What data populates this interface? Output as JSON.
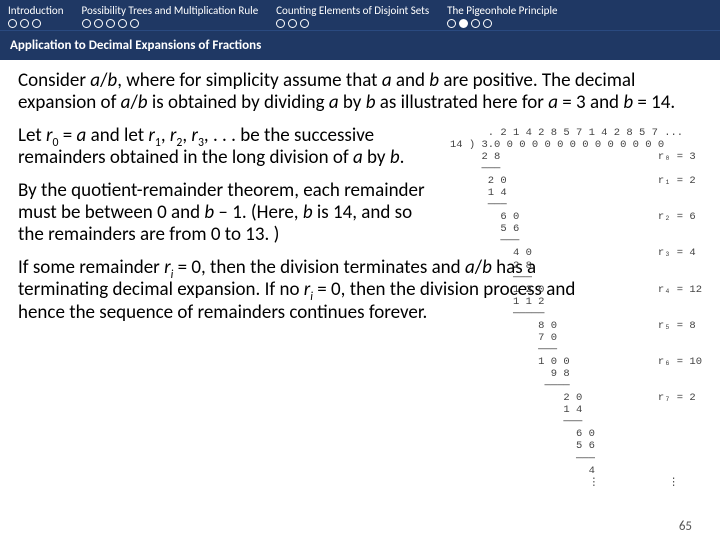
{
  "nav": {
    "sections": [
      {
        "title": "Introduction",
        "dots": [
          "o",
          "o",
          "o"
        ]
      },
      {
        "title": "Possibility Trees and Multiplication Rule",
        "dots": [
          "o",
          "o",
          "o",
          "o",
          "o"
        ]
      },
      {
        "title": "Counting Elements of Disjoint Sets",
        "dots": [
          "o",
          "o",
          "o"
        ]
      },
      {
        "title": "The Pigeonhole Principle",
        "dots": [
          "o",
          "f",
          "o",
          "o"
        ]
      }
    ]
  },
  "subtitle": "Application to Decimal Expansions of Fractions",
  "p1": {
    "t1": "Consider ",
    "ab1": "a",
    "slash1": "/",
    "ab2": "b",
    "t2": ", where for simplicity assume that ",
    "a": "a",
    "t3": " and ",
    "b": "b",
    "t4": " are positive. The decimal expansion of ",
    "ab3": "a",
    "slash2": "/",
    "ab4": "b",
    "t5": " is obtained by dividing ",
    "a2": "a",
    "t6": " by ",
    "b2": "b",
    "t7": " as illustrated here for ",
    "a3": "a",
    "eq3": " = 3 and ",
    "b3": "b",
    "eq14": " = 14."
  },
  "p2": {
    "t1": "Let ",
    "r": "r",
    "s0": "0",
    "eq": " = ",
    "a": "a",
    "t2": " and let ",
    "r1": "r",
    "s1": "1",
    "c1": ", ",
    "r2": "r",
    "s2": "2",
    "c2": ", ",
    "r3": "r",
    "s3": "3",
    "c3": ", . . . be the successive remainders obtained in the long division of ",
    "a2": "a",
    "by": " by ",
    "b": "b",
    "dot": "."
  },
  "p3": {
    "t1": "By the quotient-remainder theorem, each remainder must be between 0 and ",
    "b": "b",
    "t2": " – 1. (Here, ",
    "b2": "b",
    "t3": " is 14, and so the remainders are from 0 to 13. )"
  },
  "p4": {
    "t1": "If some remainder ",
    "r": "r",
    "si": "i",
    "t2": " = 0, then the division terminates and ",
    "a": "a",
    "slash": "/",
    "b": "b",
    "t3": " has a terminating decimal expansion. If no ",
    "r2": "r",
    "si2": "i",
    "t4": " = 0, then the division process and hence the sequence of remainders continues forever."
  },
  "longdiv": "      . 2 1 4 2 8 5 7 1 4 2 8 5 7 ...\n14 ) 3.0 0 0 0 0 0 0 0 0 0 0 0 0 0\n     2 8                         r₀ = 3\n     ───\n      2 0                        r₁ = 2\n      1 4\n      ───\n        6 0                      r₂ = 6\n        5 6\n        ───\n          4 0                    r₃ = 4\n          2 8\n          ───\n          1 2 0                  r₄ = 12\n          1 1 2\n          ─────\n              8 0                r₅ = 8\n              7 0\n              ───\n              1 0 0              r₆ = 10\n                9 8\n               ────\n                  2 0            r₇ = 2\n                  1 4\n                  ───\n                    6 0\n                    5 6\n                    ───\n                      4\n                      ⋮           ⋮",
  "pagenum": "65"
}
